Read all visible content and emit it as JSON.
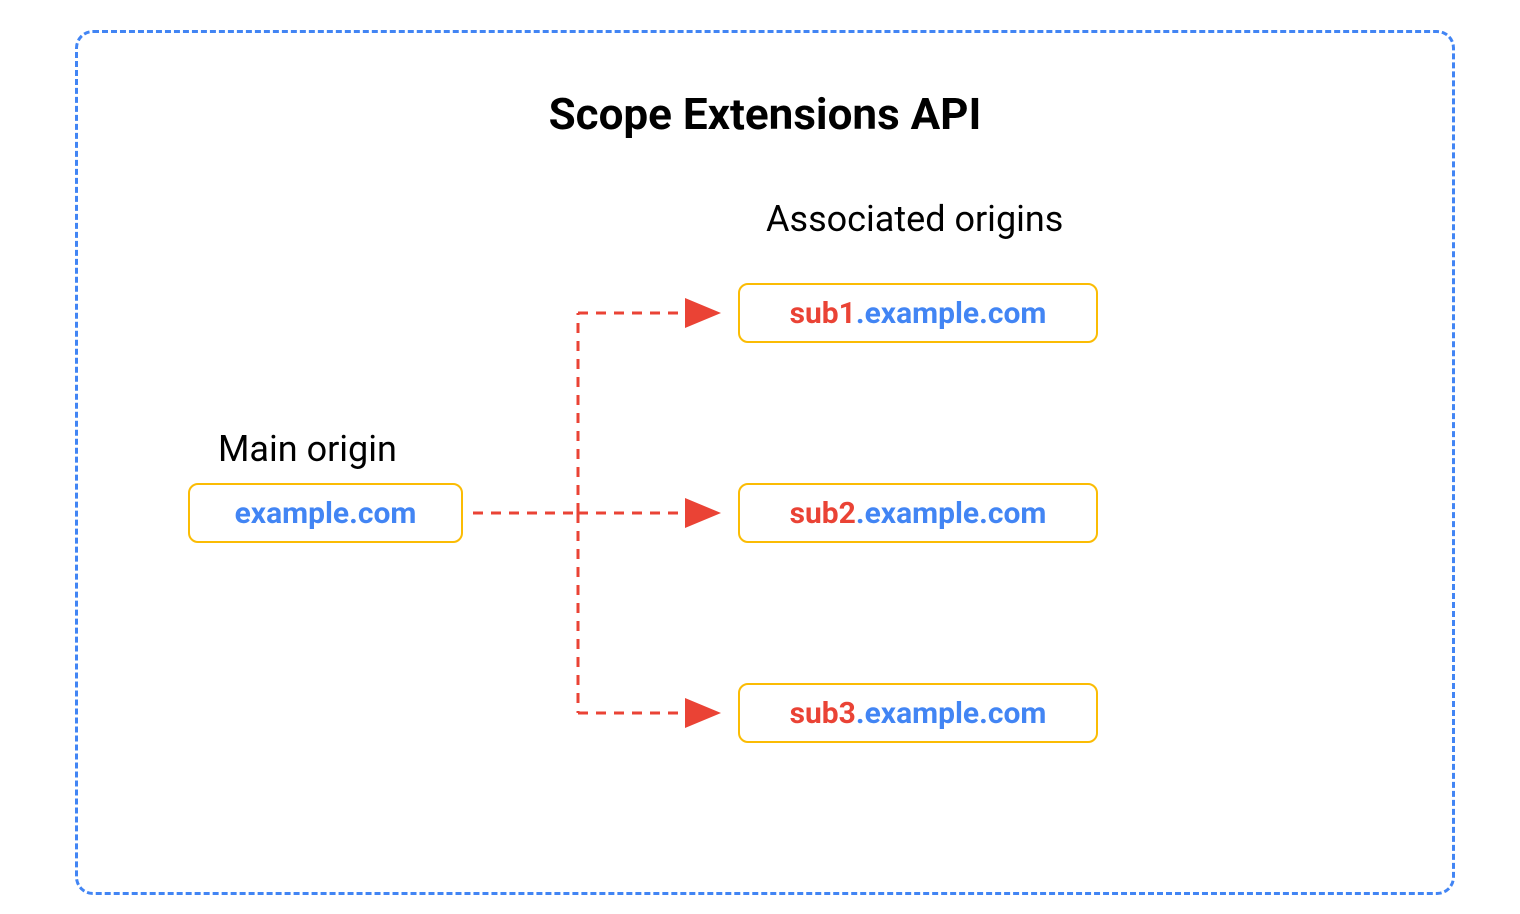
{
  "title": "Scope Extensions API",
  "mainOrigin": {
    "label": "Main origin",
    "domain": "example.com"
  },
  "associatedOrigins": {
    "label": "Associated origins",
    "items": [
      {
        "sub": "sub1",
        "domain": ".example.com"
      },
      {
        "sub": "sub2",
        "domain": ".example.com"
      },
      {
        "sub": "sub3",
        "domain": ".example.com"
      }
    ]
  },
  "colors": {
    "blue": "#4285F4",
    "red": "#EA4335",
    "yellow": "#FBBC04"
  }
}
